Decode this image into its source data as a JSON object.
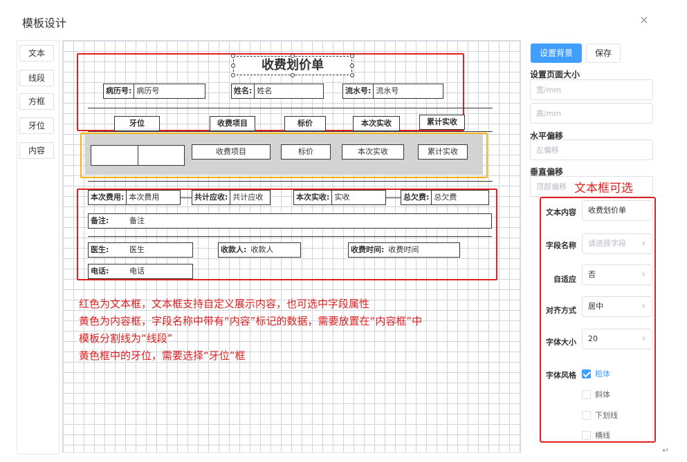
{
  "dialog": {
    "title": "模板设计",
    "close_symbol": "×"
  },
  "toolbox": {
    "items": [
      "文本",
      "线段",
      "方框",
      "牙位",
      "内容"
    ]
  },
  "canvas": {
    "title_text": "收费划价单",
    "header_fields": [
      {
        "label": "病历号:",
        "value": "病历号"
      },
      {
        "label": "姓名:",
        "value": "姓名"
      },
      {
        "label": "流水号:",
        "value": "流水号"
      }
    ],
    "column_headers": [
      "牙位",
      "收费项目",
      "标价",
      "本次实收",
      "累计实收"
    ],
    "content_cells": [
      "收费项目",
      "标价",
      "本次实收",
      "累计实收"
    ],
    "footer_row1": [
      {
        "label": "本次费用:",
        "value": "本次费用"
      },
      {
        "label": "共计应收:",
        "value": "共计应收"
      },
      {
        "label": "本次实收:",
        "value": "实收"
      },
      {
        "label": "总欠费:",
        "value": "总欠费"
      }
    ],
    "remark": {
      "label": "备注:",
      "value": "备注"
    },
    "footer_row3": [
      {
        "label": "医生:",
        "value": "医生"
      },
      {
        "label": "收款人:",
        "value": "收款人"
      },
      {
        "label": "收费时间:",
        "value": "收费时间"
      }
    ],
    "phone": {
      "label": "电话:",
      "value": "电话"
    },
    "notes": [
      "红色为文本框，文本框支持自定义展示内容，也可选中字段属性",
      "黄色为内容框，字段名称中带有“内容”标记的数据，需要放置在“内容框”中",
      "模板分割线为“线段”",
      "黄色框中的牙位，需要选择“牙位”框"
    ]
  },
  "right_panel": {
    "set_background_button": "设置背景",
    "save_button": "保存",
    "page_size_label": "设置页面大小",
    "width_placeholder": "宽/mm",
    "height_placeholder": "高/mm",
    "h_offset_label": "水平偏移",
    "h_offset_placeholder": "左偏移",
    "v_offset_label": "垂直偏移",
    "v_offset_placeholder": "顶部偏移",
    "annotation": "文本框可选",
    "props": {
      "text_content_label": "文本内容",
      "text_content_value": "收费划价单",
      "field_name_label": "字段名称",
      "field_name_placeholder": "请选择字段",
      "adaptive_label": "自适应",
      "adaptive_value": "否",
      "align_label": "对齐方式",
      "align_value": "居中",
      "font_size_label": "字体大小",
      "font_size_value": "20",
      "font_style_label": "字体风格",
      "styles": [
        {
          "label": "粗体",
          "checked": true
        },
        {
          "label": "斜体",
          "checked": false
        },
        {
          "label": "下划线",
          "checked": false
        },
        {
          "label": "横线",
          "checked": false
        }
      ]
    }
  },
  "colors": {
    "accent": "#409eff",
    "text_box": "#e02020",
    "content_box": "#f5b316"
  }
}
